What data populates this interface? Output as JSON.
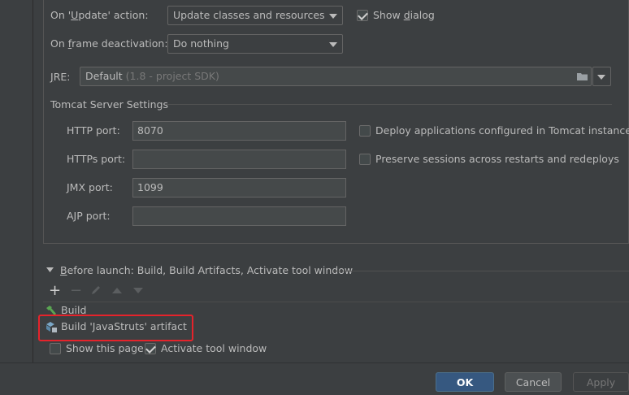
{
  "update_action": {
    "label_prefix": "On '",
    "label_mnemonic": "U",
    "label_suffix": "pdate' action:",
    "value": "Update classes and resources",
    "show_dialog_prefix": "Show ",
    "show_dialog_mnemonic": "d",
    "show_dialog_suffix": "ialog",
    "show_dialog_checked": true
  },
  "frame_deactivation": {
    "label_prefix": "On ",
    "label_mnemonic": "f",
    "label_suffix": "rame deactivation:",
    "value": "Do nothing"
  },
  "jre": {
    "label_mnemonic": "J",
    "label_suffix": "RE:",
    "value": "Default",
    "hint": "(1.8 - project SDK)"
  },
  "tomcat": {
    "section_title": "Tomcat Server Settings",
    "http_port_label": "HTTP port:",
    "http_port_value": "8070",
    "https_port_label": "HTTPs port:",
    "https_port_value": "",
    "jmx_port_label": "JMX port:",
    "jmx_port_value": "1099",
    "ajp_port_label": "AJP port:",
    "ajp_port_value": "",
    "deploy_label": "Deploy applications configured in Tomcat instance",
    "deploy_checked": false,
    "preserve_label": "Preserve sessions across restarts and redeploys",
    "preserve_checked": false
  },
  "before_launch": {
    "title_mnemonic": "B",
    "title_suffix": "efore launch: Build, Build Artifacts, Activate tool window",
    "items": [
      {
        "label": "Build",
        "icon": "hammer-icon"
      },
      {
        "label": "Build 'JavaStruts' artifact",
        "icon": "artifact-icon"
      }
    ],
    "show_this_page_label": "Show this page",
    "show_this_page_checked": false,
    "activate_tool_window_label": "Activate tool window",
    "activate_tool_window_checked": true
  },
  "buttons": {
    "ok": "OK",
    "cancel": "Cancel",
    "apply": "Apply"
  },
  "colors": {
    "highlight": "#e5232b",
    "primary_button": "#365880"
  }
}
